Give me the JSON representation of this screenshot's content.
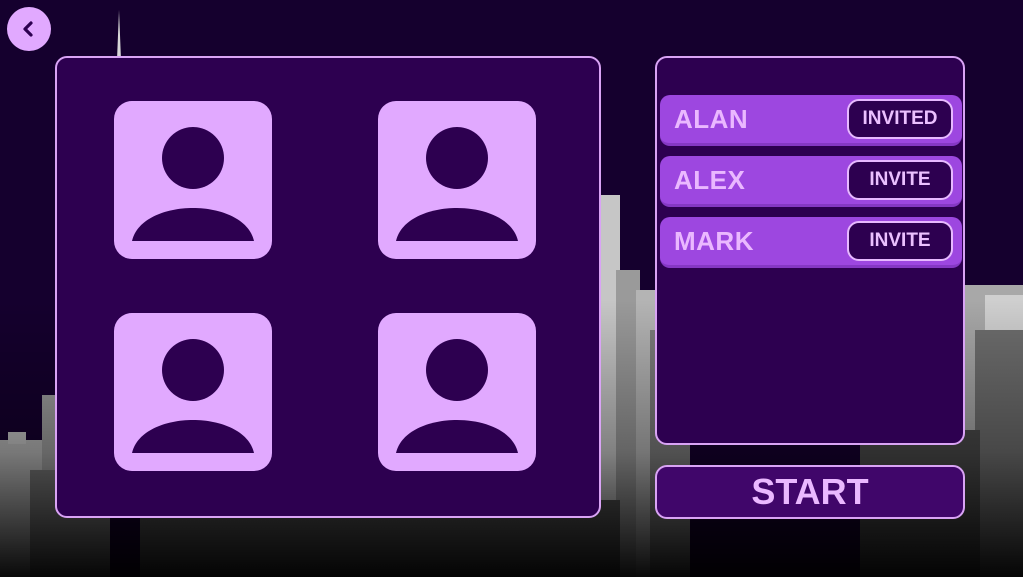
{
  "screen": "party-lobby",
  "colors": {
    "background": "#15002e",
    "panel": "#2d0050",
    "panel_border": "#d9a3f5",
    "accent_light": "#e1a9ff",
    "row": "#9d47e0",
    "text": "#eab8ff"
  },
  "back_button": {
    "icon": "chevron-left-icon"
  },
  "player_slots": [
    {
      "icon": "person-icon"
    },
    {
      "icon": "person-icon"
    },
    {
      "icon": "person-icon"
    },
    {
      "icon": "person-icon"
    }
  ],
  "friends": [
    {
      "name": "ALAN",
      "action": "INVITED"
    },
    {
      "name": "ALEX",
      "action": "INVITE"
    },
    {
      "name": "MARK",
      "action": "INVITE"
    }
  ],
  "start_label": "START"
}
